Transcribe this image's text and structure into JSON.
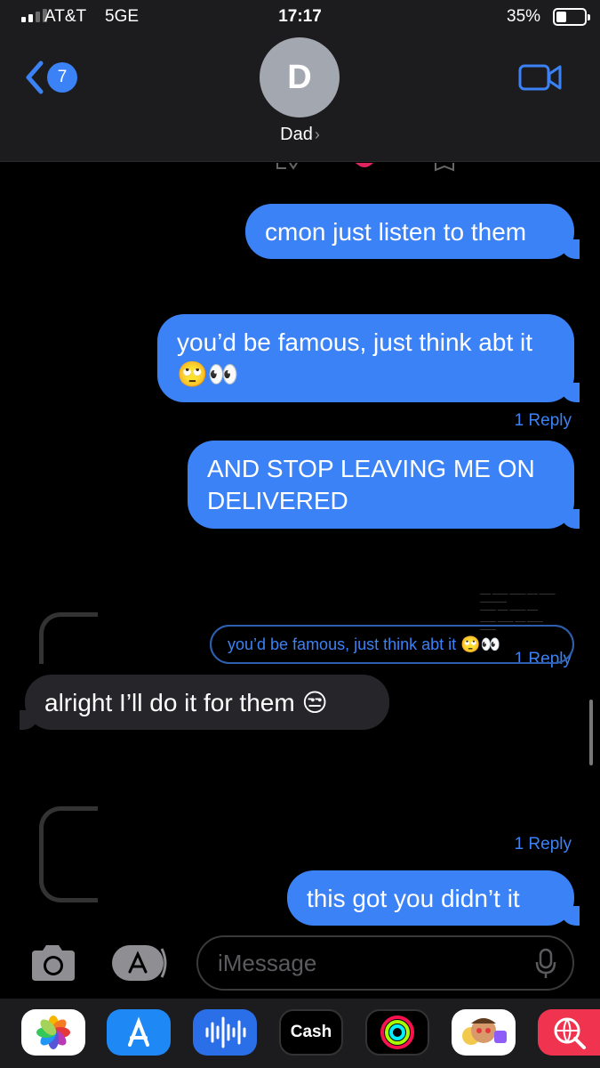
{
  "status_bar": {
    "carrier": "AT&T",
    "network": "5GE",
    "time": "17:17",
    "battery": "35%",
    "battery_level": 0.35
  },
  "nav": {
    "back_count": "7",
    "avatar_initial": "D",
    "contact_name": "Dad"
  },
  "messages": [
    {
      "text": "cmon just listen to them",
      "direction": "outgoing"
    },
    {
      "text": "you’d be famous, just think abt it 🙄👀",
      "direction": "outgoing",
      "reply_count": "1 Reply"
    },
    {
      "text": "AND STOP LEAVING ME ON DELIVERED",
      "direction": "outgoing"
    },
    {
      "text": "alright I’ll do it for them 😒",
      "direction": "incoming"
    },
    {
      "text": "this got you didn’t it",
      "direction": "outgoing"
    }
  ],
  "reply_labels": [
    "1 Reply",
    "1 Reply",
    "1 Reply"
  ],
  "quoted": "you’d be famous, just think abt it 🙄👀",
  "input": {
    "placeholder": "iMessage"
  },
  "apps": [
    "photos-icon",
    "app-store-icon",
    "audio-message-icon",
    "Cash",
    "activity-icon",
    "memoji-icon",
    "search-images-icon"
  ],
  "colors": {
    "bubble_out": "#3b82f6",
    "bubble_in": "#26262a",
    "header_bg": "#1c1c1e",
    "accent": "#3b82f6"
  }
}
